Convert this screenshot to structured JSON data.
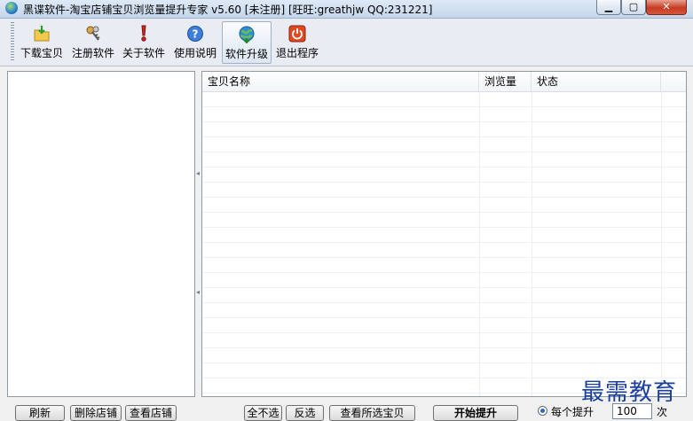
{
  "window": {
    "title": "黑谍软件-淘宝店铺宝贝浏览量提升专家 v5.60 [未注册] [旺旺:greathjw QQ:231221]",
    "controls": {
      "minimize": "▁",
      "maximize": "▢",
      "close": "✕"
    }
  },
  "toolbar": {
    "items": [
      {
        "label": "下载宝贝",
        "icon": "download-folder-icon"
      },
      {
        "label": "注册软件",
        "icon": "keys-icon"
      },
      {
        "label": "关于软件",
        "icon": "exclamation-icon"
      },
      {
        "label": "使用说明",
        "icon": "help-icon"
      },
      {
        "label": "软件升级",
        "icon": "globe-update-icon",
        "active": true
      },
      {
        "label": "退出程序",
        "icon": "power-icon"
      }
    ]
  },
  "table": {
    "columns": [
      "宝贝名称",
      "浏览量",
      "状态"
    ],
    "rows": []
  },
  "bottom": {
    "buttons_left": [
      "刷新",
      "删除店铺",
      "查看店铺"
    ],
    "buttons_mid": [
      "全不选",
      "反选",
      "查看所选宝贝"
    ],
    "start_button": "开始提升",
    "radio_label": "每个提升",
    "count_value": "100",
    "count_unit": "次"
  },
  "watermark": "最需教育"
}
